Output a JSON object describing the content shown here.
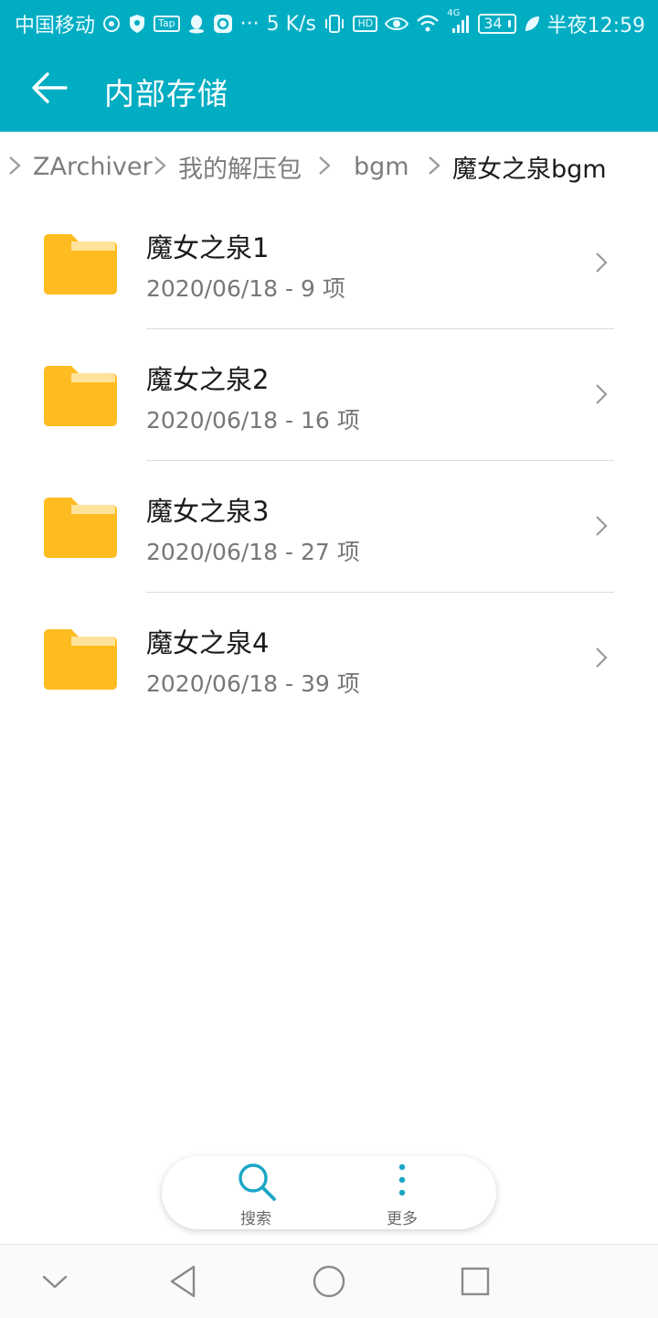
{
  "status_bar": {
    "carrier": "中国移动",
    "speed": "5 K/s",
    "dots": "···",
    "tap_label": "Tap",
    "hd_label": "HD",
    "network_label": "4G",
    "battery": "34",
    "time": "半夜12:59",
    "icons": [
      "netease-music-icon",
      "shield-icon",
      "tap-icon",
      "qq-icon",
      "app-icon",
      "vibrate-icon",
      "hd-icon",
      "eye-icon",
      "wifi-icon",
      "signal-icon",
      "battery-icon",
      "leaf-icon"
    ]
  },
  "app_bar": {
    "title": "内部存储",
    "back_icon": "arrow-left-icon",
    "color": "#00adc3"
  },
  "breadcrumb": {
    "items": [
      "ZArchiver",
      "我的解压包",
      "bgm",
      "魔女之泉bgm"
    ]
  },
  "files": [
    {
      "name": "魔女之泉1",
      "meta": "2020/06/18 - 9 项"
    },
    {
      "name": "魔女之泉2",
      "meta": "2020/06/18 - 16 项"
    },
    {
      "name": "魔女之泉3",
      "meta": "2020/06/18 - 27 项"
    },
    {
      "name": "魔女之泉4",
      "meta": "2020/06/18 - 39 项"
    }
  ],
  "toolbar": {
    "search_label": "搜索",
    "more_label": "更多",
    "accent": "#1aa6c4"
  },
  "folder_color": "#ffbc20",
  "nav": {
    "icons": [
      "collapse-icon",
      "back-triangle-icon",
      "home-circle-icon",
      "recents-square-icon"
    ]
  }
}
